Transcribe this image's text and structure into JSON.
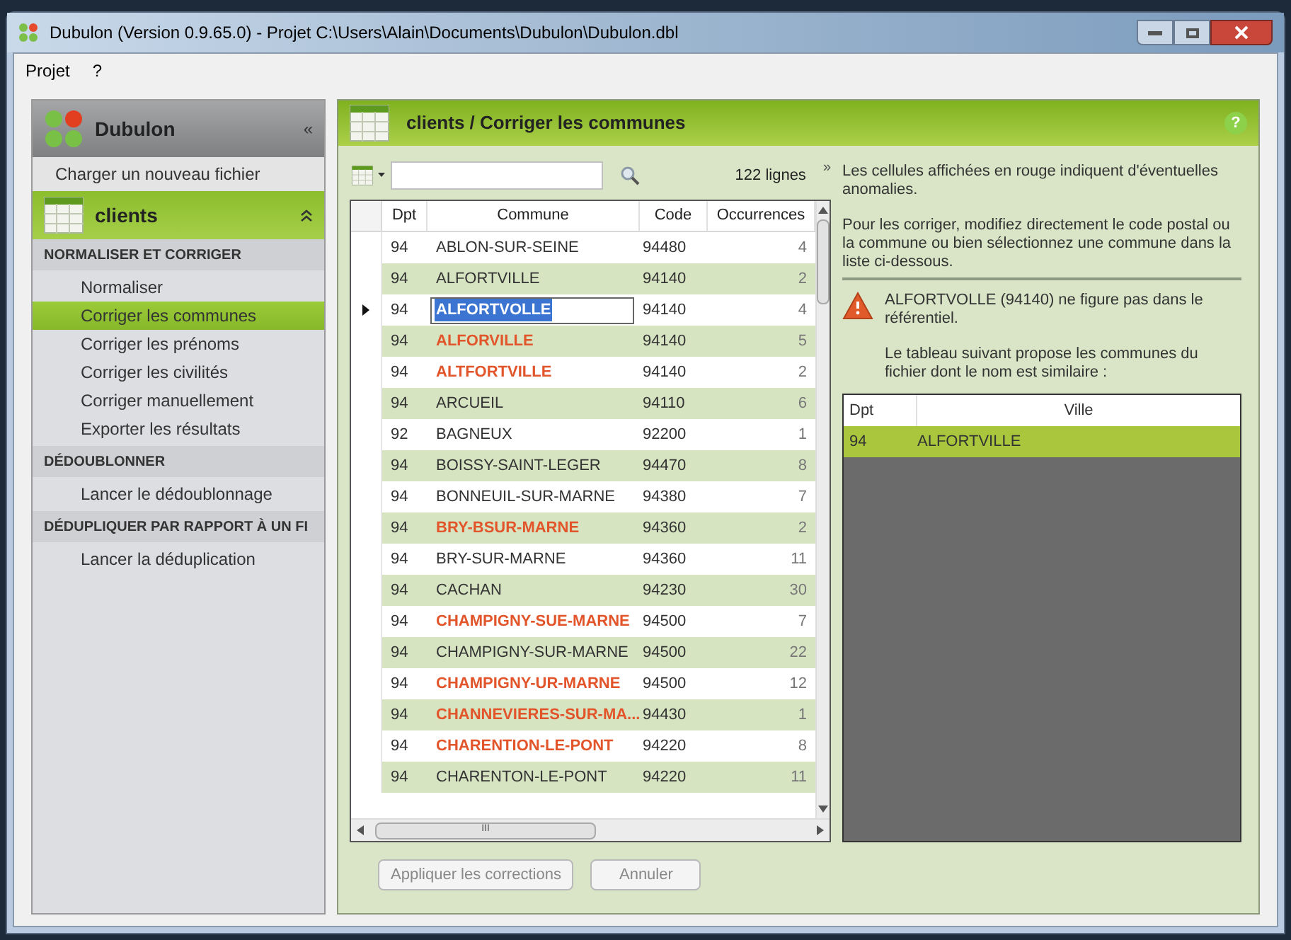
{
  "window": {
    "title": "Dubulon (Version 0.9.65.0) - Projet C:\\Users\\Alain\\Documents\\Dubulon\\Dubulon.dbl"
  },
  "menu": [
    "Projet",
    "?"
  ],
  "sidebar": {
    "title": "Dubulon",
    "collapse": "«",
    "load_link": "Charger un nouveau fichier",
    "group": "clients",
    "sections": [
      {
        "title": "NORMALISER ET CORRIGER",
        "items": [
          {
            "label": "Normaliser",
            "selected": false
          },
          {
            "label": "Corriger les communes",
            "selected": true
          },
          {
            "label": "Corriger les prénoms",
            "selected": false
          },
          {
            "label": "Corriger les civilités",
            "selected": false
          },
          {
            "label": "Corriger manuellement",
            "selected": false
          },
          {
            "label": "Exporter les résultats",
            "selected": false
          }
        ]
      },
      {
        "title": "DÉDOUBLONNER",
        "items": [
          {
            "label": "Lancer le dédoublonnage",
            "selected": false
          }
        ]
      },
      {
        "title": "DÉDUPLIQUER PAR RAPPORT À UN FI",
        "items": [
          {
            "label": "Lancer la déduplication",
            "selected": false
          }
        ]
      }
    ]
  },
  "panel": {
    "title": "clients / Corriger les communes",
    "help": "?"
  },
  "toolbar": {
    "count": "122 lignes",
    "expand": "»"
  },
  "table": {
    "columns": [
      "Dpt",
      "Commune",
      "Code",
      "Occurrences"
    ],
    "scroll_mark": "III",
    "rows": [
      {
        "dpt": "94",
        "commune": "ABLON-SUR-SEINE",
        "code": "94480",
        "occ": "4",
        "anomaly": false,
        "current": false
      },
      {
        "dpt": "94",
        "commune": "ALFORTVILLE",
        "code": "94140",
        "occ": "2",
        "anomaly": false,
        "current": false
      },
      {
        "dpt": "94",
        "commune": "ALFORTVOLLE",
        "code": "94140",
        "occ": "4",
        "anomaly": true,
        "current": true
      },
      {
        "dpt": "94",
        "commune": "ALFORVILLE",
        "code": "94140",
        "occ": "5",
        "anomaly": true,
        "current": false
      },
      {
        "dpt": "94",
        "commune": "ALTFORTVILLE",
        "code": "94140",
        "occ": "2",
        "anomaly": true,
        "current": false
      },
      {
        "dpt": "94",
        "commune": "ARCUEIL",
        "code": "94110",
        "occ": "6",
        "anomaly": false,
        "current": false
      },
      {
        "dpt": "92",
        "commune": "BAGNEUX",
        "code": "92200",
        "occ": "1",
        "anomaly": false,
        "current": false
      },
      {
        "dpt": "94",
        "commune": "BOISSY-SAINT-LEGER",
        "code": "94470",
        "occ": "8",
        "anomaly": false,
        "current": false
      },
      {
        "dpt": "94",
        "commune": "BONNEUIL-SUR-MARNE",
        "code": "94380",
        "occ": "7",
        "anomaly": false,
        "current": false
      },
      {
        "dpt": "94",
        "commune": "BRY-BSUR-MARNE",
        "code": "94360",
        "occ": "2",
        "anomaly": true,
        "current": false
      },
      {
        "dpt": "94",
        "commune": "BRY-SUR-MARNE",
        "code": "94360",
        "occ": "11",
        "anomaly": false,
        "current": false
      },
      {
        "dpt": "94",
        "commune": "CACHAN",
        "code": "94230",
        "occ": "30",
        "anomaly": false,
        "current": false
      },
      {
        "dpt": "94",
        "commune": "CHAMPIGNY-SUE-MARNE",
        "code": "94500",
        "occ": "7",
        "anomaly": true,
        "current": false
      },
      {
        "dpt": "94",
        "commune": "CHAMPIGNY-SUR-MARNE",
        "code": "94500",
        "occ": "22",
        "anomaly": false,
        "current": false
      },
      {
        "dpt": "94",
        "commune": "CHAMPIGNY-UR-MARNE",
        "code": "94500",
        "occ": "12",
        "anomaly": true,
        "current": false
      },
      {
        "dpt": "94",
        "commune": "CHANNEVIERES-SUR-MA...",
        "code": "94430",
        "occ": "1",
        "anomaly": true,
        "current": false
      },
      {
        "dpt": "94",
        "commune": "CHARENTION-LE-PONT",
        "code": "94220",
        "occ": "8",
        "anomaly": true,
        "current": false
      },
      {
        "dpt": "94",
        "commune": "CHARENTON-LE-PONT",
        "code": "94220",
        "occ": "11",
        "anomaly": false,
        "current": false
      }
    ]
  },
  "buttons": [
    {
      "label": "Appliquer les corrections",
      "disabled": true
    },
    {
      "label": "Annuler",
      "disabled": true
    }
  ],
  "info": {
    "intro": "Les cellules affichées en rouge indiquent d'éventuelles anomalies.",
    "howto": "Pour les corriger, modifiez directement le code postal ou la commune ou bien sélectionnez une commune dans la liste ci-dessous.",
    "warning": "ALFORTVOLLE (94140) ne figure pas dans le référentiel.",
    "suggest": "Le tableau suivant propose les communes du fichier dont le nom est similaire :"
  },
  "suggestions": {
    "columns": [
      "Dpt",
      "Ville"
    ],
    "rows": [
      {
        "dpt": "94",
        "ville": "ALFORTVILLE",
        "selected": true
      }
    ]
  }
}
